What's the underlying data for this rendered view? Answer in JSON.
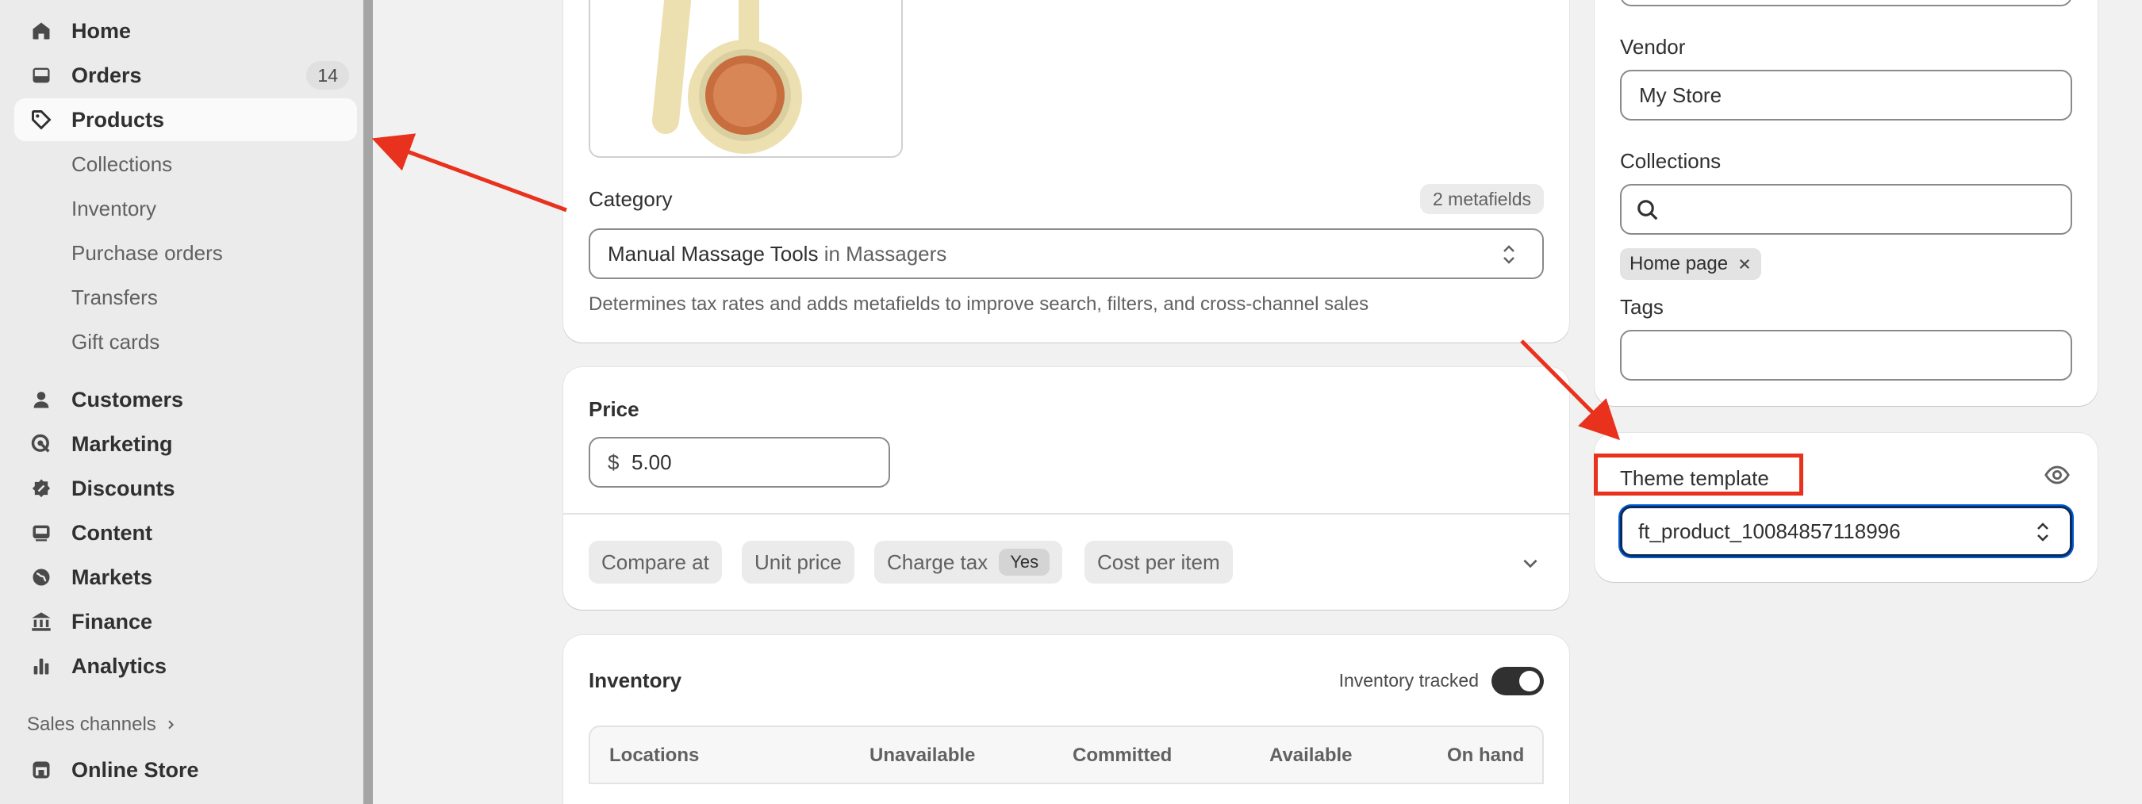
{
  "sidebar": {
    "items": [
      {
        "label": "Home",
        "icon": "home-icon"
      },
      {
        "label": "Orders",
        "icon": "inbox-icon",
        "badge": "14"
      },
      {
        "label": "Products",
        "icon": "tag-icon"
      },
      {
        "label": "Customers",
        "icon": "person-icon"
      },
      {
        "label": "Marketing",
        "icon": "target-icon"
      },
      {
        "label": "Discounts",
        "icon": "discount-icon"
      },
      {
        "label": "Content",
        "icon": "image-icon"
      },
      {
        "label": "Markets",
        "icon": "globe-icon"
      },
      {
        "label": "Finance",
        "icon": "bank-icon"
      },
      {
        "label": "Analytics",
        "icon": "bar-chart-icon"
      }
    ],
    "product_subitems": [
      "Collections",
      "Inventory",
      "Purchase orders",
      "Transfers",
      "Gift cards"
    ],
    "sales_channels_label": "Sales channels",
    "online_store_label": "Online Store"
  },
  "category": {
    "label": "Category",
    "metafields": "2 metafields",
    "value_main": "Manual Massage Tools",
    "value_suffix": "in Massagers",
    "help": "Determines tax rates and adds metafields to improve search, filters, and cross-channel sales"
  },
  "pricing": {
    "label": "Price",
    "currency": "$",
    "value": "5.00",
    "options": {
      "compare_at": "Compare at",
      "unit_price": "Unit price",
      "charge_tax": "Charge tax",
      "charge_tax_value": "Yes",
      "cost_per_item": "Cost per item"
    }
  },
  "inventory": {
    "title": "Inventory",
    "tracked_label": "Inventory tracked",
    "columns": [
      "Locations",
      "Unavailable",
      "Committed",
      "Available",
      "On hand"
    ]
  },
  "organization": {
    "vendor_label": "Vendor",
    "vendor_value": "My Store",
    "collections_label": "Collections",
    "collection_tag": "Home page",
    "tags_label": "Tags"
  },
  "theme": {
    "label": "Theme template",
    "value": "ft_product_10084857118996"
  },
  "colors": {
    "annotation": "#e8321d",
    "focus": "#005bd3",
    "toggle_on": "#303030"
  }
}
